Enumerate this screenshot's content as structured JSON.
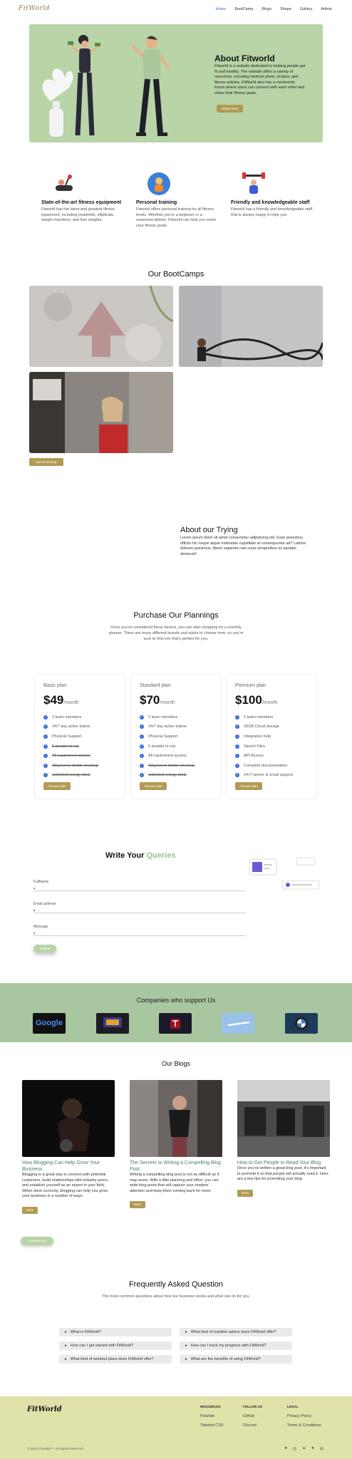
{
  "nav": {
    "logo": "FitWorld",
    "links": [
      "Home",
      "BootCamp",
      "Blogs",
      "Shope",
      "Gallery",
      "Admin"
    ],
    "active_link": "Home"
  },
  "hero": {
    "title": "About Fitworld",
    "text": "Fitworld is a website dedicated to helping people get fit and healthy. The website offers a variety of resources, including workout plans, recipes, and fitness articles. FitWorld also has a community forum where users can connect with each other and share their fitness goals.",
    "button": "Shope Now"
  },
  "features": [
    {
      "icon": "treadmill-icon",
      "title": "State-of-the-art fitness equipment",
      "text": "Fitworld has the latest and greatest fitness equipment, including treadmills, ellipticals, weight machines, and free weights."
    },
    {
      "icon": "trainer-icon",
      "title": "Personal training",
      "text": "Fitworld offers personal training for all fitness levels. Whether you're a beginner or a seasoned athlete, Fitworld can help you reach your fitness goals."
    },
    {
      "icon": "weightlifter-icon",
      "title": "Friendly and knowledgeable staff",
      "text": "Fitworld has a friendly and knowledgeable staff that is always happy to help you."
    }
  ],
  "bootcamps": {
    "title": "Our BootCamps",
    "button": "Our Bootcamp"
  },
  "about_trying": {
    "title_a": "About our ",
    "title_b": "Trying",
    "text": "Lorem ipsum dolor sit amet consectetur adipisicing elit. Esse possimus officiis hic neque atque molestiae cupiditate at consequuntur ad? Labore dolores possimus, libero sapiente nam esse temporibus ex pariatur deserunt!"
  },
  "plans": {
    "title": "Purchase Our Plannings",
    "subtitle": "Once you've considered these factors, you can start shopping for a monthly planner. There are many different brands and styles to choose from, so you're sure to find one that's perfect for you.",
    "cards": [
      {
        "name": "Basic plan",
        "currency": "$",
        "price": "49",
        "period": "/month",
        "button": "Choose plan",
        "features": [
          {
            "t": "2 team members",
            "on": true
          },
          {
            "t": "24/7 day active trainer",
            "on": true
          },
          {
            "t": "Physical Support",
            "on": true
          },
          {
            "t": "5 powder to eat",
            "on": false
          },
          {
            "t": "All equirement access",
            "on": false
          },
          {
            "t": "2day/week doctor checkup",
            "on": false
          },
          {
            "t": "unlimited energy drink",
            "on": false
          }
        ]
      },
      {
        "name": "Standard plan",
        "currency": "$",
        "price": "70",
        "period": "/month",
        "button": "Choose plan",
        "features": [
          {
            "t": "2 team members",
            "on": true
          },
          {
            "t": "24/7 day active trainer",
            "on": true
          },
          {
            "t": "Physical Support",
            "on": true
          },
          {
            "t": "5 powder to eat",
            "on": true
          },
          {
            "t": "All equirement access",
            "on": true
          },
          {
            "t": "2day/week doctor checkup",
            "on": false
          },
          {
            "t": "unlimited energy drink",
            "on": false
          }
        ]
      },
      {
        "name": "Premium plan",
        "currency": "$",
        "price": "100",
        "period": "/month",
        "button": "Choose plan",
        "features": [
          {
            "t": "2 team members",
            "on": true
          },
          {
            "t": "20GB Cloud storage",
            "on": true
          },
          {
            "t": "Integration help",
            "on": true
          },
          {
            "t": "Sketch Files",
            "on": true
          },
          {
            "t": "API Access",
            "on": true
          },
          {
            "t": "Complete documentation",
            "on": true
          },
          {
            "t": "24×7 phone & email support",
            "on": true
          }
        ]
      }
    ]
  },
  "queries": {
    "title_a": "Write Your ",
    "title_b": "Queries",
    "fields": [
      "FullName",
      "Email address",
      "Message"
    ],
    "submit": "Submit"
  },
  "companies": {
    "title": "Companies who support Us",
    "logos": [
      "google-logo",
      "screen-logo",
      "tesla-logo",
      "plane-logo",
      "bmw-logo"
    ],
    "google_text": "Google"
  },
  "blogs": {
    "title": "Our Blogs",
    "posts": [
      {
        "title": "How Blogging Can Help Grow Your Business",
        "text": "Blogging is a great way to connect with potential customers, build relationships with industry peers, and establish yourself as an expert in your field. When done correctly, blogging can help you grow your business in a number of ways.",
        "button": "More"
      },
      {
        "title": "The Secrets to Writing a Compelling Blog Post",
        "text": "Writing a compelling blog post is not as difficult as it may seem. With a little planning and effort, you can write blog posts that will capture your readers' attention and keep them coming back for more.",
        "button": "More"
      },
      {
        "title": "How to Get People to Read Your Blog",
        "text": "Once you've written a great blog post, it's important to promote it so that people will actually read it. Here are a few tips for promoting your blog",
        "button": "More"
      }
    ],
    "comment_button": "Comment Blog"
  },
  "faq": {
    "title": "Frequently Asked Question",
    "subtitle": "The most common questions about how our business works and what can do for you.",
    "items": [
      "What is FitWorld?",
      "What kind of nutrition advice does FitWorld offer?",
      "How can I get started with FitWorld?",
      "How can I track my progress with FitWorld?",
      "What kind of workout plans does FitWorld offer?",
      "What are the benefits of using FitWorld?"
    ]
  },
  "footer": {
    "logo": "FitWorld",
    "columns": [
      {
        "heading": "RESOURCES",
        "links": [
          "Flowbite",
          "Tailwind CSS"
        ]
      },
      {
        "heading": "FOLLOW US",
        "links": [
          "Github",
          "Discord"
        ]
      },
      {
        "heading": "LEGAL",
        "links": [
          "Privacy Policy",
          "Terms & Conditions"
        ]
      }
    ],
    "copyright": "© 2023 Flowbite™. All Rights Reserved.",
    "social": [
      "facebook-icon",
      "instagram-icon",
      "twitter-icon",
      "github-icon",
      "dribbble-icon"
    ]
  },
  "colors": {
    "accent_gold": "#b19b54",
    "hero_green": "#b9d4a7",
    "band_green": "#a8c69f",
    "footer_yellow": "#dfe2a9",
    "link_blue": "#3b5bd6"
  }
}
